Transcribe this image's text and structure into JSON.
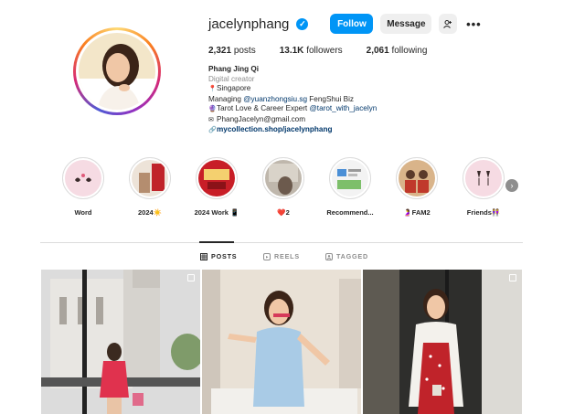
{
  "profile": {
    "username": "jacelynphang",
    "follow_label": "Follow",
    "message_label": "Message",
    "suggest_glyph": "+⎇",
    "more_glyph": "•••"
  },
  "stats": {
    "posts_count": "2,321",
    "posts_label": "posts",
    "followers_count": "13.1K",
    "followers_label": "followers",
    "following_count": "2,061",
    "following_label": "following"
  },
  "bio": {
    "full_name": "Phang Jing Qi",
    "category": "Digital creator",
    "location": "Singapore",
    "managing_prefix": "Managing ",
    "managing_tag": "@yuanzhongsiu.sg",
    "managing_suffix": " FengShui Biz",
    "tarot_text": "Tarot Love & Career Expert ",
    "tarot_tag": "@tarot_with_jacelyn",
    "email": "PhangJacelyn@gmail.com",
    "link": "mycollection.shop/jacelynphang"
  },
  "highlights": [
    {
      "label": "Word"
    },
    {
      "label": "2024☀️"
    },
    {
      "label": "2024 Work 📱"
    },
    {
      "label": "❤️2"
    },
    {
      "label": "Recommend..."
    },
    {
      "label": "🤰FAM2"
    },
    {
      "label": "Friends👭"
    }
  ],
  "tabs": {
    "posts": "POSTS",
    "reels": "REELS",
    "tagged": "TAGGED"
  },
  "colors": {
    "accent": "#0095f6",
    "text": "#262626",
    "muted": "#8e8e8e",
    "link": "#00376b"
  },
  "icons": [
    "verified-badge-icon",
    "add-person-icon",
    "more-icon",
    "pin-icon",
    "crystal-ball-icon",
    "mail-icon",
    "link-icon",
    "grid-icon",
    "reels-icon",
    "tagged-icon",
    "chevron-right-icon",
    "multi-post-icon"
  ]
}
